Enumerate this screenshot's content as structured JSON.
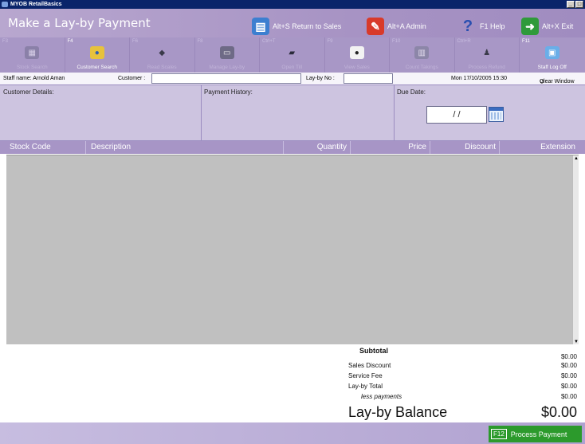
{
  "window": {
    "title": "MYOB RetailBasics"
  },
  "header": {
    "page_title": "Make a Lay-by Payment",
    "actions": [
      {
        "label": "Alt+S Return to Sales",
        "icon": "register-icon"
      },
      {
        "label": "Alt+A Admin",
        "icon": "admin-icon"
      },
      {
        "label": "F1 Help",
        "icon": "help-icon"
      },
      {
        "label": "Alt+X Exit",
        "icon": "exit-icon"
      }
    ]
  },
  "toolbar": [
    {
      "key": "F3",
      "label": "Stock Search",
      "icon": "stock-search-icon",
      "enabled": false
    },
    {
      "key": "F4",
      "label": "Customer Search",
      "icon": "customer-search-icon",
      "enabled": true
    },
    {
      "key": "F6",
      "label": "Read Scales",
      "icon": "scales-icon",
      "enabled": false
    },
    {
      "key": "F8",
      "label": "Manage Lay-by",
      "icon": "lay-by-icon",
      "enabled": false
    },
    {
      "key": "Ctrl+T",
      "label": "Open Till",
      "icon": "till-icon",
      "enabled": false
    },
    {
      "key": "F9",
      "label": "View Sales",
      "icon": "view-sales-icon",
      "enabled": false
    },
    {
      "key": "F10",
      "label": "Count Takings",
      "icon": "count-takings-icon",
      "enabled": false
    },
    {
      "key": "Ctrl+R",
      "label": "Process Refund",
      "icon": "refund-icon",
      "enabled": false
    },
    {
      "key": "F11",
      "label": "Staff Log Off",
      "icon": "log-off-icon",
      "enabled": true
    }
  ],
  "info": {
    "staff_label": "Staff name: Arnold Aman",
    "customer_label": "Customer :",
    "customer_value": "",
    "layby_label": "Lay-by No :",
    "layby_value": "",
    "datetime": "Mon 17/10/2005 15:30",
    "clear_window": "Clear Window"
  },
  "details": {
    "customer_details": "Customer Details:",
    "payment_history": "Payment History:",
    "due_date_label": "Due Date:",
    "due_date_value": "/ /"
  },
  "table": {
    "columns": [
      "Stock Code",
      "Description",
      "Quantity",
      "Price",
      "Discount",
      "Extension"
    ],
    "rows": []
  },
  "totals": {
    "subtotal_label": "Subtotal",
    "subtotal": "$0.00",
    "sales_discount_label": "Sales Discount",
    "sales_discount": "$0.00",
    "service_fee_label": "Service Fee",
    "service_fee": "$0.00",
    "layby_total_label": "Lay-by Total",
    "layby_total": "$0.00",
    "less_payments_label": "less payments",
    "less_payments": "$0.00",
    "balance_label": "Lay-by Balance",
    "balance": "$0.00"
  },
  "footer": {
    "process_key": "F12",
    "process_label": "Process Payment"
  },
  "colors": {
    "titlebar": "#0a246a",
    "header": "#a793c4",
    "panel": "#cdc4e0",
    "grid": "#c0c0c0",
    "process_button": "#2c9a2c"
  }
}
